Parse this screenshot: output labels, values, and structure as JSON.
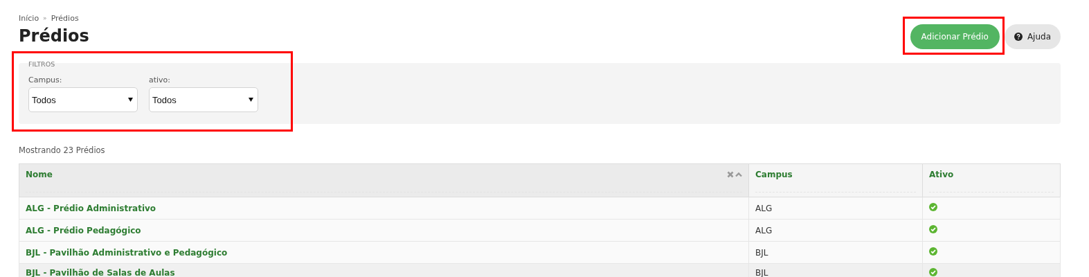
{
  "breadcrumb": [
    "Início",
    "Prédios"
  ],
  "breadcrumb_separator": "»",
  "title": "Prédios",
  "actions": [
    {
      "kind": "primary",
      "label": "Adicionar Prédio"
    },
    {
      "kind": "help",
      "label": "Ajuda"
    }
  ],
  "filters": {
    "legend": "FILTROS",
    "fields": [
      {
        "label": "Campus:",
        "value": "Todos"
      },
      {
        "label": "ativo:",
        "value": "Todos"
      }
    ]
  },
  "count_text": "Mostrando 23 Prédios",
  "table": {
    "columns": [
      {
        "label": "Nome",
        "sorted": true
      },
      {
        "label": "Campus",
        "sorted": false
      },
      {
        "label": "Ativo",
        "sorted": false
      }
    ],
    "rows": [
      {
        "nome": "ALG - Prédio Administrativo",
        "campus": "ALG",
        "ativo": true
      },
      {
        "nome": "ALG - Prédio Pedagógico",
        "campus": "ALG",
        "ativo": true
      },
      {
        "nome": "BJL - Pavilhão Administrativo e Pedagógico",
        "campus": "BJL",
        "ativo": true
      },
      {
        "nome": "BJL - Pavilhão de Salas de Aulas",
        "campus": "BJL",
        "ativo": true
      }
    ]
  }
}
